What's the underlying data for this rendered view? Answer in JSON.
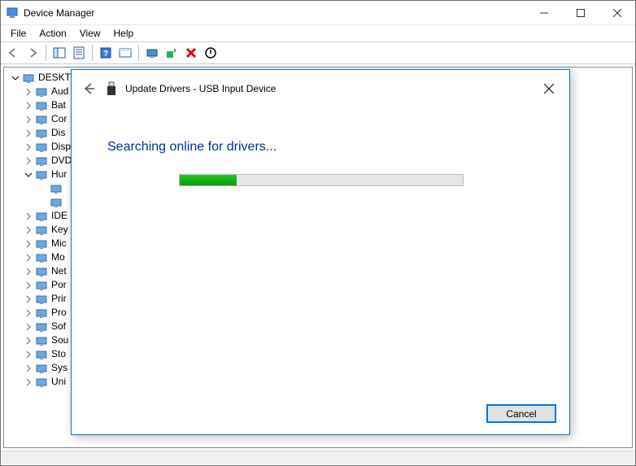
{
  "window": {
    "title": "Device Manager"
  },
  "menu": {
    "file": "File",
    "action": "Action",
    "view": "View",
    "help": "Help"
  },
  "tree": {
    "root": "DESKTO",
    "items": [
      {
        "label": "Aud",
        "expander": ">",
        "child": false
      },
      {
        "label": "Bat",
        "expander": ">",
        "child": false
      },
      {
        "label": "Cor",
        "expander": ">",
        "child": false
      },
      {
        "label": "Dis",
        "expander": ">",
        "child": false
      },
      {
        "label": "Disp",
        "expander": ">",
        "child": false
      },
      {
        "label": "DVD",
        "expander": ">",
        "child": false
      },
      {
        "label": "Hur",
        "expander": "v",
        "child": false
      },
      {
        "label": "",
        "expander": "",
        "child": true
      },
      {
        "label": "",
        "expander": "",
        "child": true
      },
      {
        "label": "IDE",
        "expander": ">",
        "child": false
      },
      {
        "label": "Key",
        "expander": ">",
        "child": false
      },
      {
        "label": "Mic",
        "expander": ">",
        "child": false
      },
      {
        "label": "Mo",
        "expander": ">",
        "child": false
      },
      {
        "label": "Net",
        "expander": ">",
        "child": false
      },
      {
        "label": "Por",
        "expander": ">",
        "child": false
      },
      {
        "label": "Prir",
        "expander": ">",
        "child": false
      },
      {
        "label": "Pro",
        "expander": ">",
        "child": false
      },
      {
        "label": "Sof",
        "expander": ">",
        "child": false
      },
      {
        "label": "Sou",
        "expander": ">",
        "child": false
      },
      {
        "label": "Sto",
        "expander": ">",
        "child": false
      },
      {
        "label": "Sys",
        "expander": ">",
        "child": false
      },
      {
        "label": "Uni",
        "expander": ">",
        "child": false
      }
    ]
  },
  "dialog": {
    "title": "Update Drivers - USB Input Device",
    "status": "Searching online for drivers...",
    "progress_percent": 20,
    "cancel": "Cancel"
  }
}
